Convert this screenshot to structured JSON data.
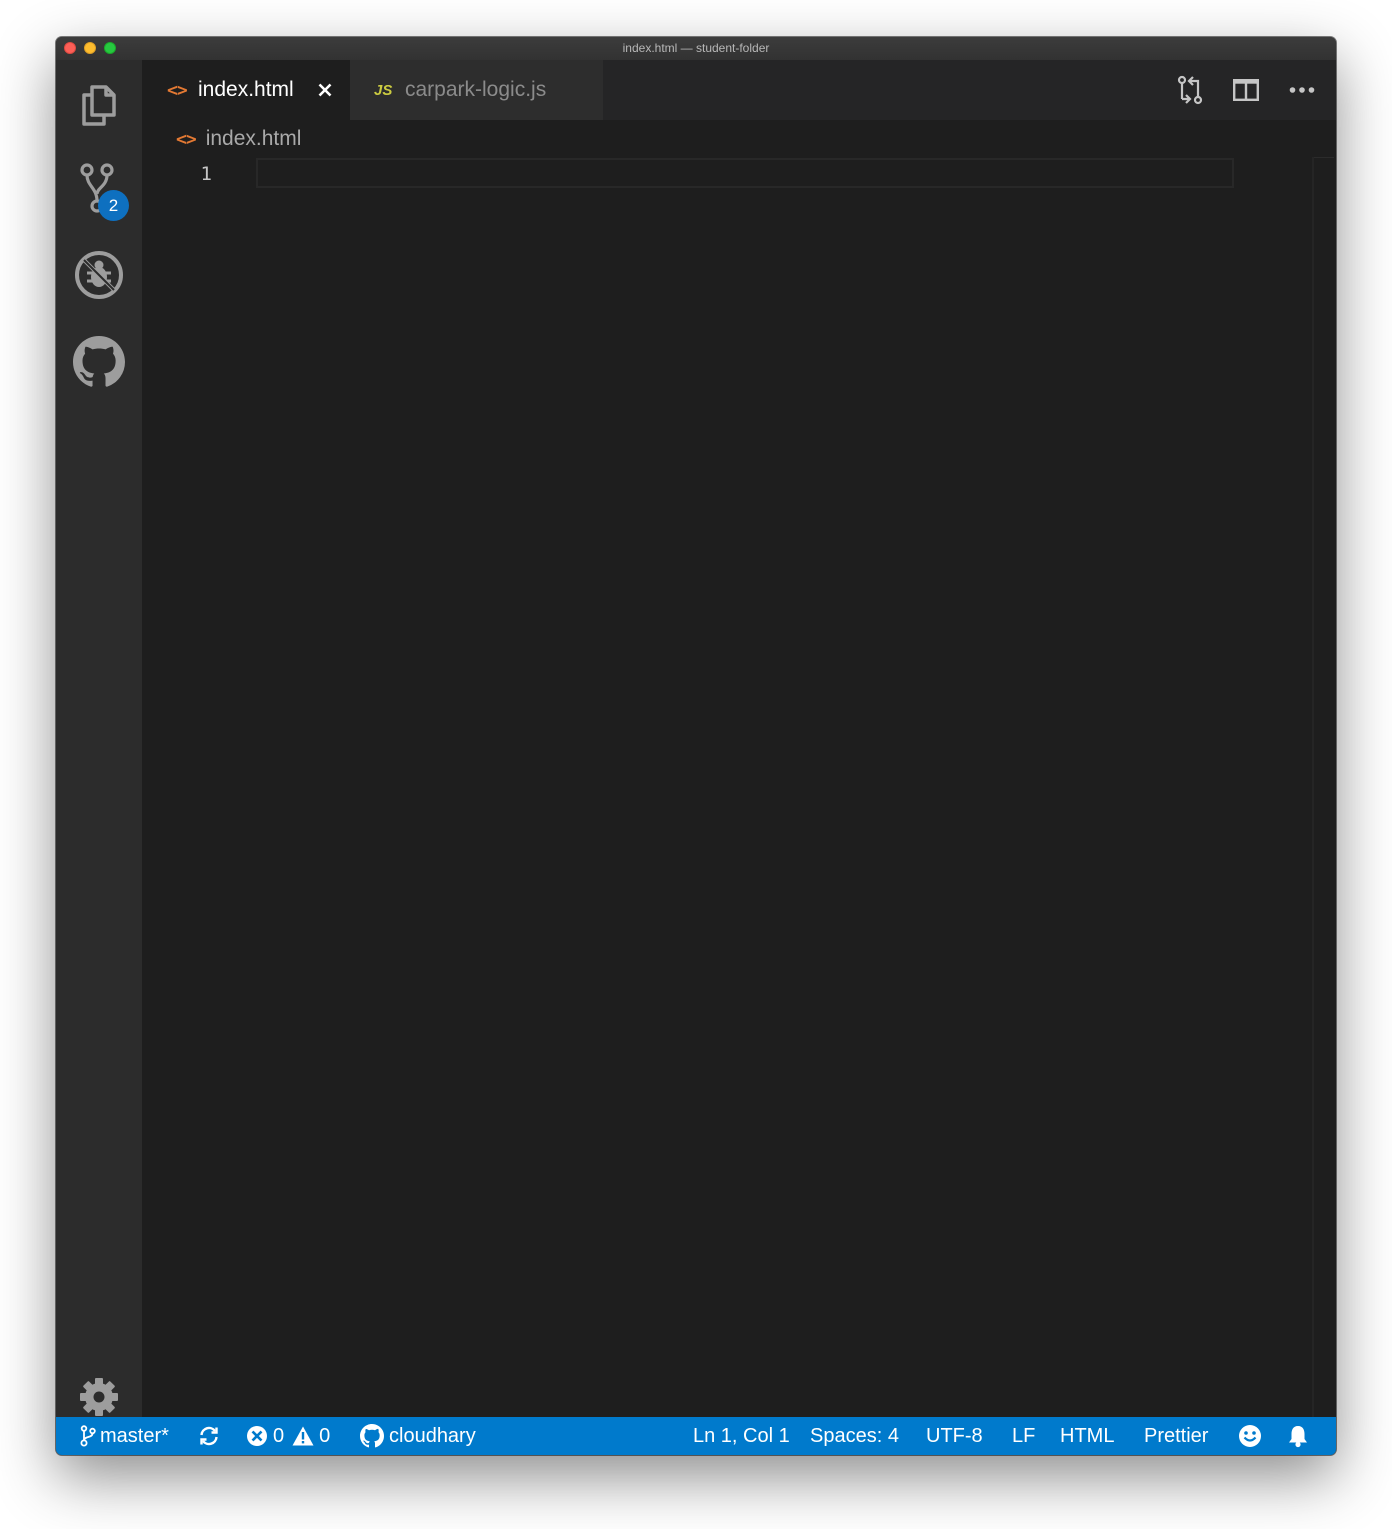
{
  "window": {
    "title": "index.html — student-folder"
  },
  "activity_bar": {
    "items": [
      {
        "name": "explorer",
        "icon": "files-icon"
      },
      {
        "name": "source-control",
        "icon": "source-control-icon",
        "badge": "2"
      },
      {
        "name": "debug",
        "icon": "debug-icon"
      },
      {
        "name": "github",
        "icon": "github-icon"
      }
    ],
    "settings_icon": "gear-icon"
  },
  "tabs": [
    {
      "label": "index.html",
      "icon": "html-file-icon",
      "active": true,
      "glyph": "<>",
      "close": "✕"
    },
    {
      "label": "carpark-logic.js",
      "icon": "js-file-icon",
      "active": false,
      "glyph": "JS"
    }
  ],
  "editor_actions": [
    "open-changes-icon",
    "split-editor-icon",
    "more-actions-icon"
  ],
  "breadcrumb": {
    "glyph": "<>",
    "label": "index.html"
  },
  "editor": {
    "line_numbers": [
      "1"
    ],
    "content": ""
  },
  "status_bar": {
    "branch": "master*",
    "errors": "0",
    "warnings": "0",
    "github_user": "cloudhary",
    "cursor": "Ln 1, Col 1",
    "indent": "Spaces: 4",
    "encoding": "UTF-8",
    "eol": "LF",
    "language": "HTML",
    "formatter": "Prettier",
    "background": "#007acc"
  },
  "colors": {
    "editor_bg": "#1e1e1e",
    "activity_bar_bg": "#2c2c2c",
    "tab_bar_bg": "#252526",
    "accent": "#007acc",
    "badge": "#0e70c0",
    "html_icon": "#e37933",
    "js_icon": "#cbcb41"
  }
}
